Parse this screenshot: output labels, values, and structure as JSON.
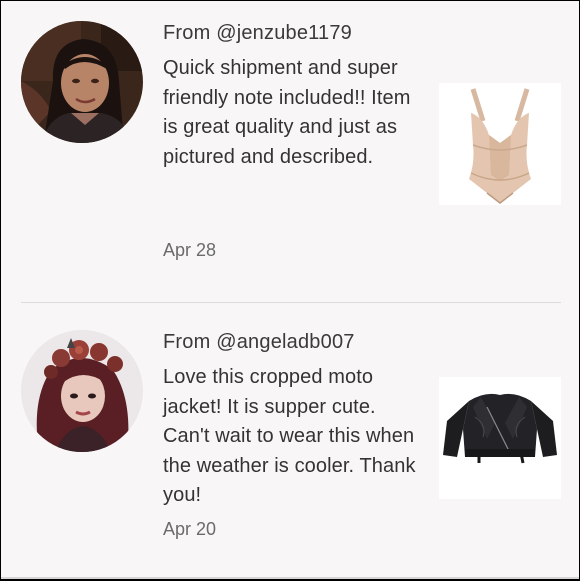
{
  "reviews": [
    {
      "from": "From @jenzube1179",
      "comment": "Quick shipment and super friendly note included!! Item is great quality and just as pictured and described.",
      "date": "Apr 28",
      "avatar_icon": "user-avatar-photo",
      "item_icon": "bodysuit-shapewear-image"
    },
    {
      "from": "From @angeladb007",
      "comment": "Love this cropped moto jacket! It is supper cute.  Can't wait to wear this when the weather is cooler. Thank you!",
      "date": "Apr 20",
      "avatar_icon": "user-avatar-photo",
      "item_icon": "moto-jacket-image"
    }
  ],
  "colors": {
    "background": "#f8f6f7",
    "text": "#333333",
    "muted": "#6b6b6b",
    "divider": "#dedbdc"
  }
}
